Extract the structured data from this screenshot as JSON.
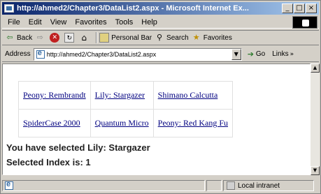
{
  "window": {
    "title": "http://ahmed2/Chapter3/DataList2.aspx - Microsoft Internet Ex...",
    "controls": [
      "_",
      "□",
      "×"
    ]
  },
  "menu": {
    "items": [
      "File",
      "Edit",
      "View",
      "Favorites",
      "Tools",
      "Help"
    ]
  },
  "toolbar": {
    "back_label": "Back",
    "forward_glyph": "⇨",
    "back_glyph": "⇦",
    "personal_bar_label": "Personal Bar",
    "search_label": "Search",
    "favorites_label": "Favorites"
  },
  "address": {
    "label": "Address",
    "url": "http://ahmed2/Chapter3/DataList2.aspx",
    "go_label": "Go",
    "links_label": "Links"
  },
  "datalist": {
    "rows": [
      [
        "Peony: Rembrandt",
        "Lily: Stargazer",
        "Shimano Calcutta"
      ],
      [
        "SpiderCase 2000",
        "Quantum Micro",
        "Peony: Red Kang Fu"
      ]
    ]
  },
  "messages": {
    "selected": "You have selected Lily: Stargazer",
    "index": "Selected Index is:  1"
  },
  "status": {
    "zone": "Local intranet"
  },
  "colors": {
    "link": "#000080",
    "titlebar_start": "#0a246a",
    "chrome": "#d4d0c8"
  }
}
